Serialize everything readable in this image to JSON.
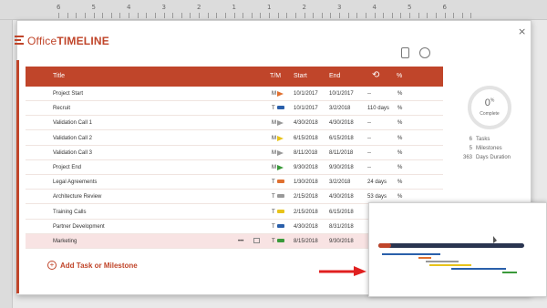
{
  "app": {
    "logo_text_1": "Office",
    "logo_text_2": "TIMELINE"
  },
  "ruler": {
    "numbers": [
      "6",
      "5",
      "4",
      "3",
      "2",
      "1",
      "1",
      "2",
      "3",
      "4",
      "5",
      "6"
    ]
  },
  "icons": {
    "clipboard": "clipboard-icon",
    "clock": "clock-icon",
    "close": "close-icon"
  },
  "close_glyph": "×",
  "header": {
    "title": "Title",
    "tm": "T/M",
    "start": "Start",
    "end": "End",
    "pct": "%"
  },
  "rows": [
    {
      "title": "Project Start",
      "tm": "M",
      "kind": "flag",
      "color": "#e07030",
      "start": "10/1/2017",
      "end": "10/1/2017",
      "dur": "--",
      "pct": "%"
    },
    {
      "title": "Recruit",
      "tm": "T",
      "kind": "bar",
      "color": "#2a5faa",
      "start": "10/1/2017",
      "end": "3/2/2018",
      "dur": "110 days",
      "pct": "%"
    },
    {
      "title": "Validation Call 1",
      "tm": "M",
      "kind": "flag",
      "color": "#999999",
      "start": "4/30/2018",
      "end": "4/30/2018",
      "dur": "--",
      "pct": "%"
    },
    {
      "title": "Validation Call 2",
      "tm": "M",
      "kind": "flag",
      "color": "#e8c31a",
      "start": "6/15/2018",
      "end": "6/15/2018",
      "dur": "--",
      "pct": "%"
    },
    {
      "title": "Validation Call 3",
      "tm": "M",
      "kind": "flag",
      "color": "#999999",
      "start": "8/11/2018",
      "end": "8/11/2018",
      "dur": "--",
      "pct": "%"
    },
    {
      "title": "Project End",
      "tm": "M",
      "kind": "flag",
      "color": "#3a9a3a",
      "start": "9/30/2018",
      "end": "9/30/2018",
      "dur": "--",
      "pct": "%"
    },
    {
      "title": "Legal Agreements",
      "tm": "T",
      "kind": "bar",
      "color": "#e07030",
      "start": "1/30/2018",
      "end": "3/2/2018",
      "dur": "24 days",
      "pct": "%"
    },
    {
      "title": "Architecture Review",
      "tm": "T",
      "kind": "bar",
      "color": "#999999",
      "start": "2/15/2018",
      "end": "4/30/2018",
      "dur": "53 days",
      "pct": "%"
    },
    {
      "title": "Training Calls",
      "tm": "T",
      "kind": "bar",
      "color": "#e8c31a",
      "start": "2/15/2018",
      "end": "6/15/2018",
      "dur": "",
      "pct": ""
    },
    {
      "title": "Partner Development",
      "tm": "T",
      "kind": "bar",
      "color": "#2a5faa",
      "start": "4/30/2018",
      "end": "8/31/2018",
      "dur": "",
      "pct": ""
    },
    {
      "title": "Marketing",
      "tm": "T",
      "kind": "bar",
      "color": "#3a9a3a",
      "start": "8/15/2018",
      "end": "9/30/2018",
      "dur": "",
      "pct": ""
    }
  ],
  "row_actions": {
    "more": "•••"
  },
  "add_label": "Add Task or Milestone",
  "add_glyph": "+",
  "side": {
    "percent": "0",
    "percent_sign": "%",
    "complete_label": "Complete",
    "tasks_count": "6",
    "tasks_label": "Tasks",
    "milestones_count": "5",
    "milestones_label": "Milestones",
    "days_count": "363",
    "days_label": "Days Duration"
  },
  "colors": {
    "accent": "#c0452a",
    "highlight_arrow": "#e02020"
  }
}
